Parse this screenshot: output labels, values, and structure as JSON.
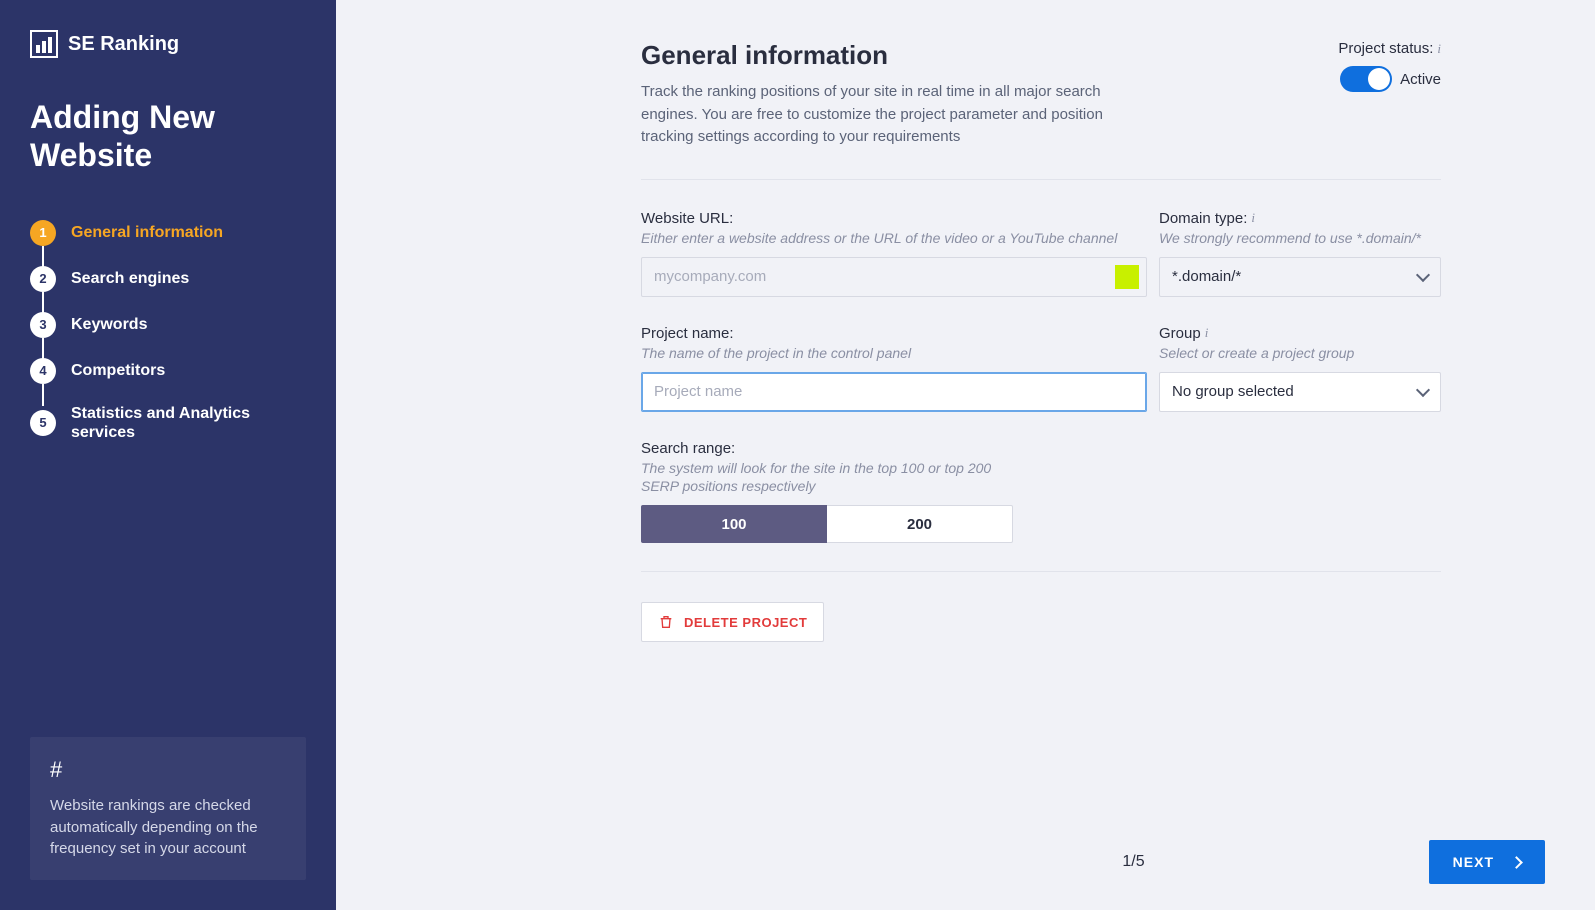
{
  "brand": "SE Ranking",
  "sidebar": {
    "title": "Adding New Website",
    "steps": [
      {
        "num": "1",
        "label": "General information",
        "active": true
      },
      {
        "num": "2",
        "label": "Search engines",
        "active": false
      },
      {
        "num": "3",
        "label": "Keywords",
        "active": false
      },
      {
        "num": "4",
        "label": "Competitors",
        "active": false
      },
      {
        "num": "5",
        "label": "Statistics and Analytics services",
        "active": false
      }
    ],
    "info": "Website rankings are checked automatically depending on the frequency set in your account"
  },
  "header": {
    "title": "General information",
    "desc": "Track the ranking positions of your site in real time in all major search engines. You are free to customize the project parameter and position tracking settings according to your requirements"
  },
  "status": {
    "label": "Project status:",
    "value": "Active",
    "on": true
  },
  "fields": {
    "url": {
      "label": "Website URL:",
      "hint": "Either enter a website address or the URL of the video or a YouTube channel",
      "placeholder": "mycompany.com",
      "value": ""
    },
    "domain_type": {
      "label": "Domain type:",
      "hint": "We strongly recommend to use *.domain/*",
      "value": "*.domain/*"
    },
    "project_name": {
      "label": "Project name:",
      "hint": "The name of the project in the control panel",
      "placeholder": "Project name",
      "value": ""
    },
    "group": {
      "label": "Group",
      "hint": "Select or create a project group",
      "value": "No group selected"
    },
    "search_range": {
      "label": "Search range:",
      "hint": "The system will look for the site in the top 100 or top 200 SERP positions respectively",
      "options": [
        "100",
        "200"
      ],
      "selected": "100"
    }
  },
  "actions": {
    "delete": "DELETE PROJECT",
    "next": "NEXT"
  },
  "pagination": "1/5"
}
